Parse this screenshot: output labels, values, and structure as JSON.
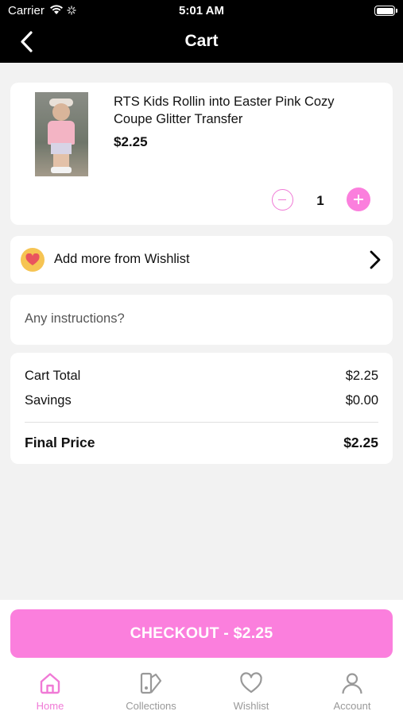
{
  "status": {
    "carrier": "Carrier",
    "time": "5:01 AM"
  },
  "nav": {
    "title": "Cart"
  },
  "cart_item": {
    "title": "RTS Kids Rollin into Easter Pink Cozy Coupe Glitter Transfer",
    "price": "$2.25",
    "quantity": "1"
  },
  "wishlist_row": {
    "label": "Add more from Wishlist"
  },
  "instructions": {
    "placeholder": "Any instructions?"
  },
  "totals": {
    "cart_total_label": "Cart Total",
    "cart_total_value": "$2.25",
    "savings_label": "Savings",
    "savings_value": "$0.00",
    "final_label": "Final Price",
    "final_value": "$2.25"
  },
  "checkout": {
    "label": "CHECKOUT - $2.25"
  },
  "tabs": [
    {
      "label": "Home",
      "icon": "home-icon",
      "active": true
    },
    {
      "label": "Collections",
      "icon": "collections-icon",
      "active": false
    },
    {
      "label": "Wishlist",
      "icon": "heart-icon",
      "active": false
    },
    {
      "label": "Account",
      "icon": "account-icon",
      "active": false
    }
  ],
  "colors": {
    "accent": "#fb7fdd",
    "accent_outline": "#f07ad6",
    "header": "#000000",
    "background": "#f2f2f2"
  }
}
